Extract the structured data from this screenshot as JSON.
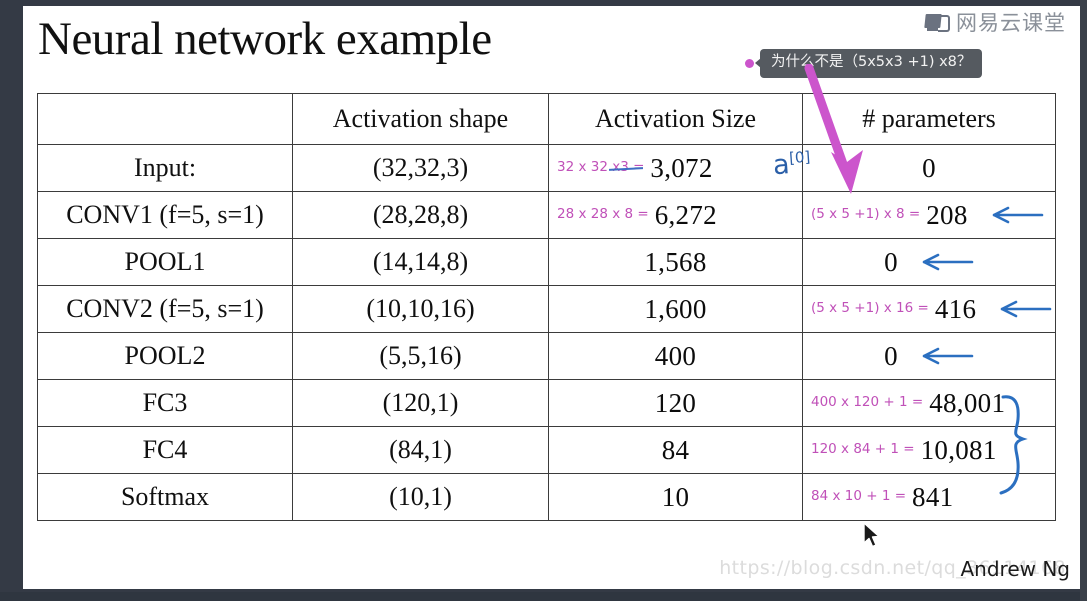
{
  "slide": {
    "title": "Neural network example",
    "footer_author": "Andrew Ng",
    "watermark": "https://blog.csdn.net/qq_36114168"
  },
  "logo": {
    "text": "网易云课堂",
    "icon": "book-icon"
  },
  "comment": {
    "text": "为什么不是（5x5x3 +1) x8？",
    "dot_color": "#cc55cc",
    "bubble_color": "#555a60"
  },
  "annotations": {
    "ink_magenta": "#c050b8",
    "ink_blue": "#2b5fa8",
    "a_superscript": "a",
    "a_superscript_index": "[0]"
  },
  "table": {
    "headers": [
      "",
      "Activation shape",
      "Activation Size",
      "# parameters"
    ],
    "rows": [
      {
        "name": "Input:",
        "shape": "(32,32,3)",
        "size": "3,072",
        "size_note": "32 x 32 x3 =",
        "params": "0",
        "params_note": "",
        "blue_arrow": false
      },
      {
        "name": "CONV1 (f=5, s=1)",
        "shape": "(28,28,8)",
        "size": "6,272",
        "size_note": "28 x 28 x 8 =",
        "params": "208",
        "params_note": "(5 x 5  +1) x 8 =",
        "blue_arrow": true
      },
      {
        "name": "POOL1",
        "shape": "(14,14,8)",
        "size": "1,568",
        "size_note": "",
        "params": "0",
        "params_note": "",
        "blue_arrow": true
      },
      {
        "name": "CONV2  (f=5, s=1)",
        "shape": "(10,10,16)",
        "size": "1,600",
        "size_note": "",
        "params": "416",
        "params_note": "(5 x 5 +1) x 16 =",
        "blue_arrow": true
      },
      {
        "name": "POOL2",
        "shape": "(5,5,16)",
        "size": "400",
        "size_note": "",
        "params": "0",
        "params_note": "",
        "blue_arrow": true
      },
      {
        "name": "FC3",
        "shape": "(120,1)",
        "size": "120",
        "size_note": "",
        "params": "48,001",
        "params_note": "400 x 120 + 1 =",
        "blue_arrow": false
      },
      {
        "name": "FC4",
        "shape": "(84,1)",
        "size": "84",
        "size_note": "",
        "params": "10,081",
        "params_note": "120 x 84 + 1 =",
        "blue_arrow": false
      },
      {
        "name": "Softmax",
        "shape": "(10,1)",
        "size": "10",
        "size_note": "",
        "params": "841",
        "params_note": "84 x 10 + 1 =",
        "blue_arrow": false
      }
    ]
  }
}
